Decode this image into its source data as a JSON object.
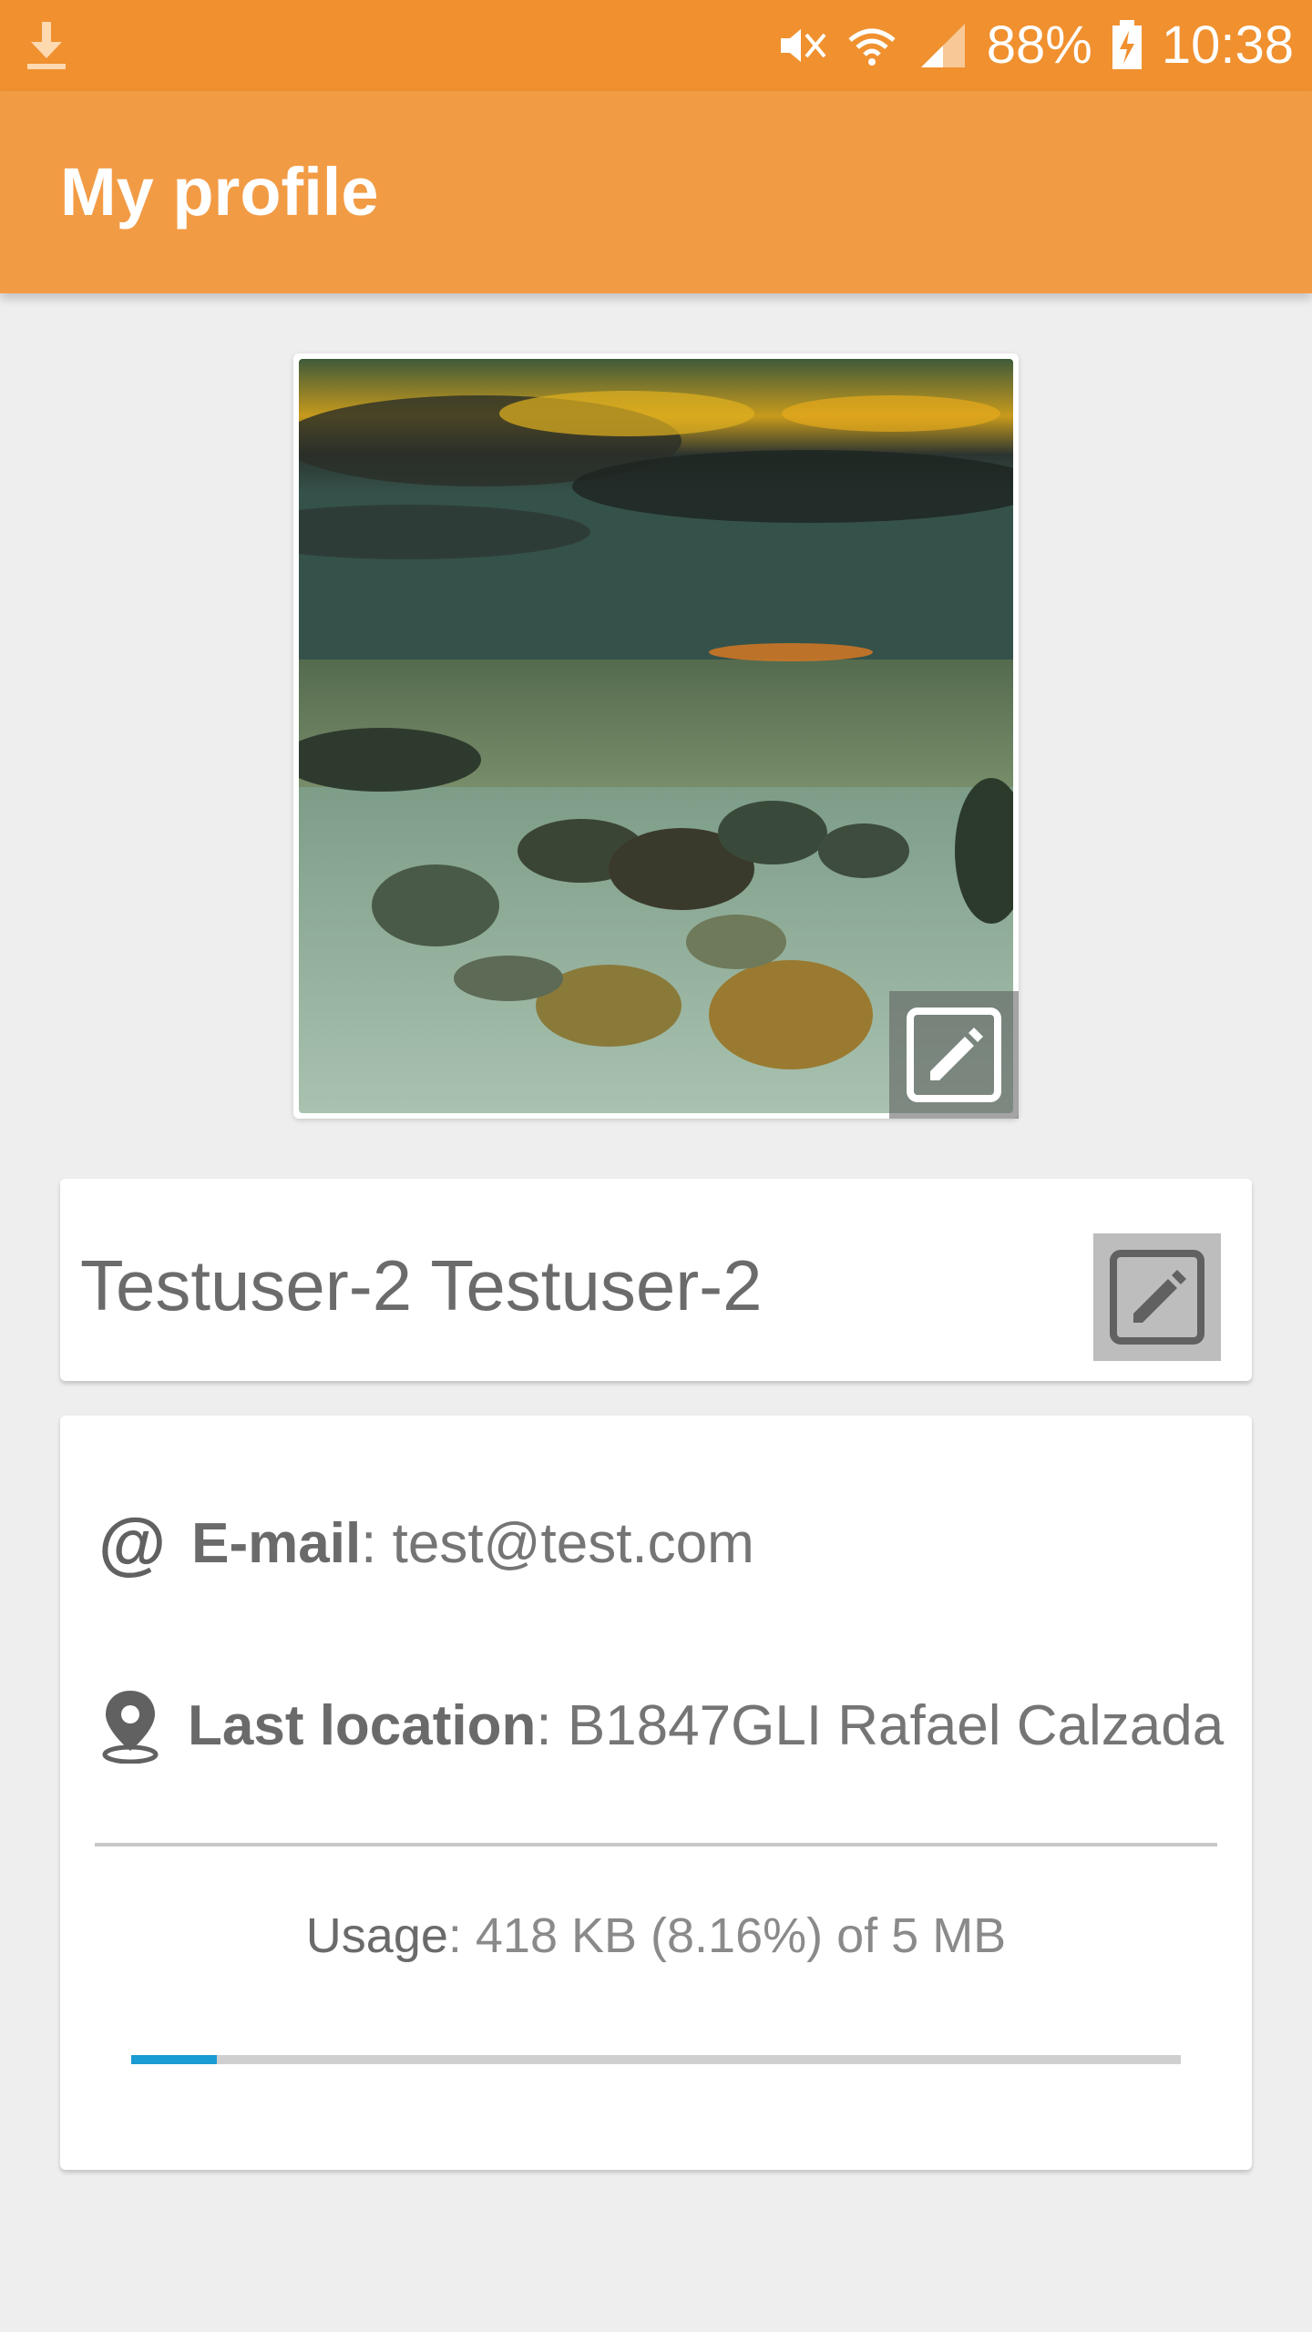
{
  "status_bar": {
    "battery": "88%",
    "time": "10:38",
    "icons": [
      "download-icon",
      "mute-icon",
      "wifi-icon",
      "signal-icon",
      "battery-charging-icon"
    ]
  },
  "app_bar": {
    "title": "My profile"
  },
  "profile": {
    "photo_alt": "",
    "name": "Testuser-2 Testuser-2"
  },
  "info": {
    "email_label": "E-mail",
    "email_value": ": test@test.com",
    "location_label": "Last location",
    "location_value": ": B1847GLI Rafael Calzada"
  },
  "usage": {
    "label": "Usage",
    "value": ": 418 KB (8.16%) of 5 MB",
    "percent": 8.16
  },
  "colors": {
    "status_bar": "#f0902f",
    "app_bar": "#f29b45",
    "progress": "#1a9bd1"
  }
}
